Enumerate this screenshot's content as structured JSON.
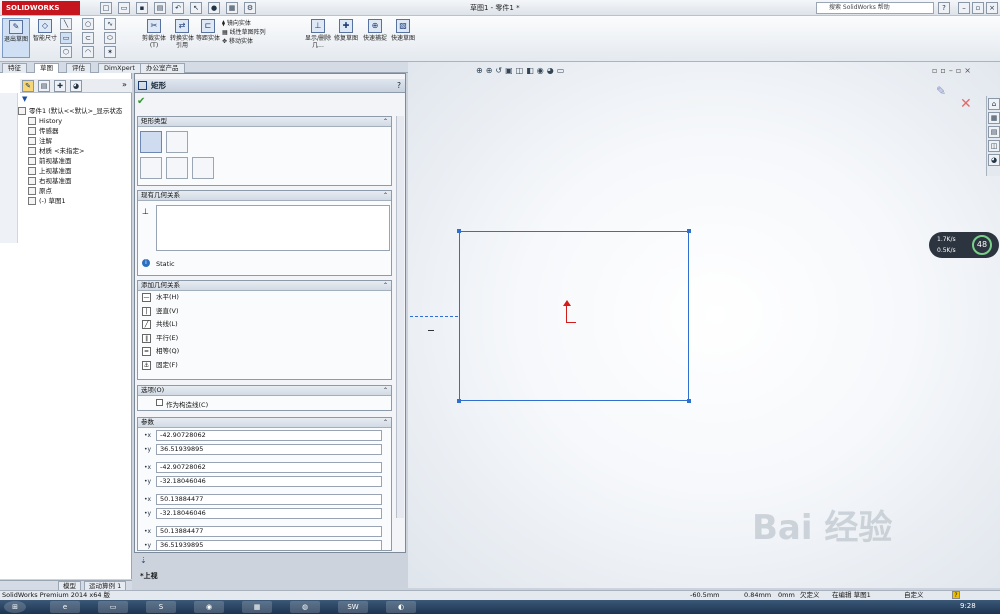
{
  "app": {
    "logo_text": "SOLIDWORKS",
    "document_title": "草图1 - 零件1 *",
    "search_placeholder": "搜索 SolidWorks 帮助"
  },
  "ribbon": {
    "buttons": [
      {
        "label": "退出草图",
        "icon": "exit-sketch-icon"
      },
      {
        "label": "智能尺寸",
        "icon": "smart-dimension-icon"
      },
      {
        "label": "剪裁实体(T)",
        "icon": "trim-icon"
      },
      {
        "label": "转换实体引用",
        "icon": "convert-icon"
      },
      {
        "label": "等距实体",
        "icon": "offset-icon"
      },
      {
        "label": "显示/删除几...",
        "icon": "display-relations-icon"
      },
      {
        "label": "修复草图",
        "icon": "repair-sketch-icon"
      },
      {
        "label": "快速捕捉",
        "icon": "quick-snap-icon"
      },
      {
        "label": "快速草图",
        "icon": "rapid-sketch-icon"
      }
    ],
    "list_items": [
      "镜向实体",
      "线性草图阵列",
      "移动实体"
    ]
  },
  "tabs": [
    "特征",
    "草图",
    "评估",
    "DimXpert",
    "办公室产品"
  ],
  "active_tab": 1,
  "feature_tree": {
    "root": "零件1 (默认<<默认>_显示状态",
    "items": [
      "History",
      "传感器",
      "注解",
      "材质 <未指定>",
      "前视基准面",
      "上视基准面",
      "右视基准面",
      "原点",
      "(-) 草图1"
    ]
  },
  "bottom_tabs": [
    "模型",
    "运动算例 1"
  ],
  "property_manager": {
    "title": "矩形",
    "help": "?",
    "groups": {
      "rect_type": {
        "header": "矩形类型"
      },
      "existing_relations": {
        "header": "现有几何关系",
        "status_text": "Static"
      },
      "add_relations": {
        "header": "添加几何关系",
        "items": [
          "水平(H)",
          "竖直(V)",
          "共线(L)",
          "平行(E)",
          "相等(Q)",
          "固定(F)"
        ]
      },
      "options": {
        "header": "选项(O)",
        "construction_label": "作为构造线(C)"
      },
      "parameters": {
        "header": "参数",
        "values": [
          "-42.90728062",
          "36.51939895",
          "-42.90728062",
          "-32.18046046",
          "50.13884477",
          "-32.18046046",
          "50.13884477",
          "36.51939895"
        ]
      }
    }
  },
  "view": {
    "view_label": "*上视",
    "gauge_top": "1.7K/s",
    "gauge_bottom": "0.5K/s",
    "gauge_percent": "48"
  },
  "status_bar": {
    "app_version": "SolidWorks Premium 2014 x64 版",
    "x": "-60.5mm",
    "y": "0.84mm",
    "z": "0mm",
    "defined": "欠定义",
    "editing": "在编辑 草图1",
    "custom": "自定义"
  },
  "taskbar": {
    "time": "9:28"
  },
  "watermark": "Bai 经验"
}
